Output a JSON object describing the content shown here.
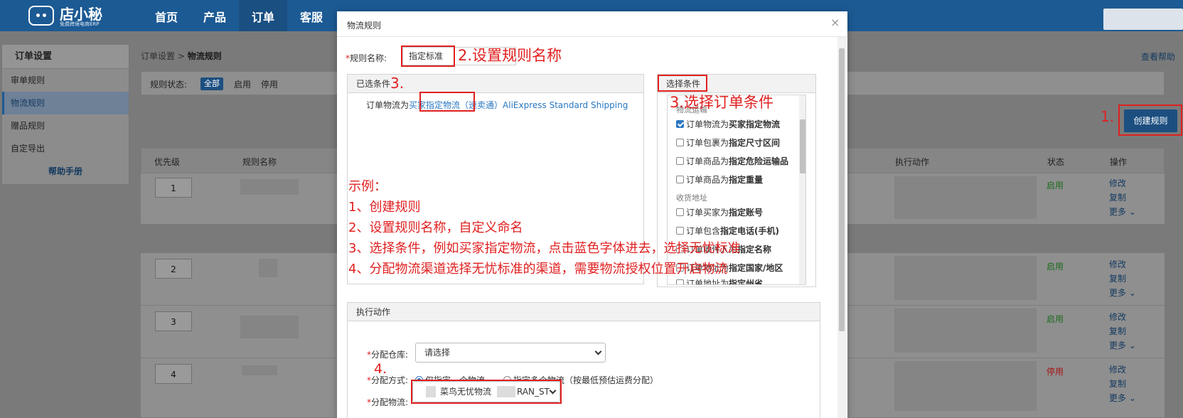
{
  "header": {
    "brand": "店小秘",
    "slogan": "免费跨境电商ERP",
    "nav": [
      "首页",
      "产品",
      "订单",
      "客服"
    ],
    "active_nav": "订单"
  },
  "sidebar": {
    "title": "订单设置",
    "items": [
      "审单规则",
      "物流规则",
      "赠品规则",
      "自定导出"
    ],
    "active": "物流规则",
    "help": "帮助手册"
  },
  "breadcrumb": {
    "parent": "订单设置",
    "separator": ">",
    "current": "物流规则"
  },
  "help_link": "查看帮助",
  "filter": {
    "label": "规则状态:",
    "options": [
      "全部",
      "启用",
      "停用"
    ],
    "selected": "全部"
  },
  "create_button": "创建规则",
  "annotation_1": "1.",
  "table": {
    "columns": [
      "优先级",
      "规则名称",
      "执行动作",
      "状态",
      "操作"
    ],
    "rows": [
      {
        "priority": "1",
        "status": "启用",
        "ops": [
          "修改",
          "复制",
          "更多"
        ]
      },
      {
        "priority": "2",
        "status": "启用",
        "ops": [
          "修改",
          "复制",
          "更多"
        ]
      },
      {
        "priority": "3",
        "status": "启用",
        "ops": [
          "修改",
          "复制",
          "更多"
        ]
      },
      {
        "priority": "4",
        "status": "停用",
        "ops": [
          "修改",
          "复制",
          "更多"
        ]
      }
    ]
  },
  "modal": {
    "title": "物流规则",
    "close": "×",
    "name_label": "规则名称:",
    "name_required": "*",
    "name_value": "指定标准",
    "annotation_2": "2.设置规则名称",
    "selected_panel": {
      "title": "已选条件",
      "annotation": "3.",
      "text_prefix": "订单物流为",
      "text_link": "买家指定物流",
      "text_suffix": "（速卖通）AliExpress Standard Shipping"
    },
    "condition_panel": {
      "title": "选择条件",
      "annotation": "3.选择订单条件",
      "group_transport": "物流运输",
      "group_address": "收货地址",
      "items": [
        {
          "prefix": "订单物流为",
          "bold": "买家指定物流",
          "checked": true
        },
        {
          "prefix": "订单包裹为",
          "bold": "指定尺寸区间",
          "checked": false
        },
        {
          "prefix": "订单商品为",
          "bold": "指定危险运输品",
          "checked": false
        },
        {
          "prefix": "订单商品为",
          "bold": "指定重量",
          "checked": false
        },
        {
          "prefix": "订单买家为",
          "bold": "指定账号",
          "checked": false
        },
        {
          "prefix": "订单包含",
          "bold": "指定电话(手机)",
          "checked": false
        },
        {
          "prefix": "订单收件人为",
          "bold": "指定名称",
          "checked": false
        },
        {
          "prefix": "订单地址为",
          "bold": "指定国家/地区",
          "checked": false
        },
        {
          "prefix": "订单地址为",
          "bold": "指定州省",
          "checked": false
        }
      ]
    },
    "example": {
      "title": "示例：",
      "lines": [
        "1、创建规则",
        "2、设置规则名称，自定义命名",
        "3、选择条件，例如买家指定物流，点击蓝色字体进去，选择无忧标准",
        "4、分配物流渠道选择无忧标准的渠道，需要物流授权位置开启物流"
      ]
    },
    "action_panel": {
      "title": "执行动作",
      "warehouse_label": "分配仓库:",
      "warehouse_value": "请选择",
      "method_label": "分配方式:",
      "method_option_1": "仅指定一个物流",
      "method_option_2": "指定多个物流（按最低预估运费分配）",
      "logistics_label": "分配物流:",
      "logistics_value": "菜鸟无忧物流",
      "logistics_suffix": "RAN_ST",
      "annotation_4": "4.",
      "required": "*"
    }
  }
}
